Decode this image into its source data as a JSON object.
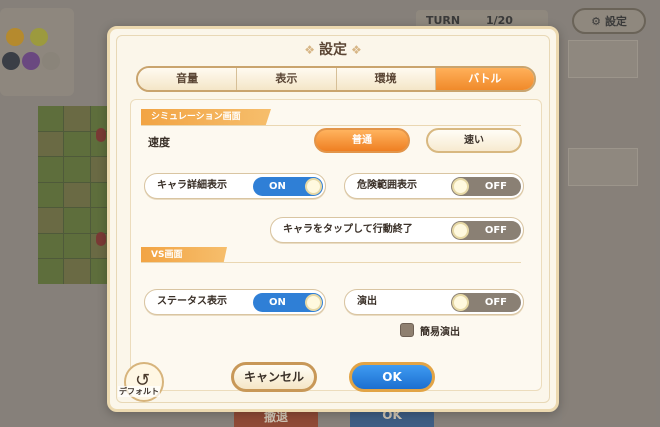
{
  "background": {
    "turn_label": "TURN",
    "turn_value": "1/20",
    "settings_button": "設定",
    "bottom_left_button": "撤退",
    "bottom_right_button": "OK"
  },
  "dialog": {
    "title": "設定",
    "tabs": [
      {
        "label": "音量",
        "active": false
      },
      {
        "label": "表示",
        "active": false
      },
      {
        "label": "環境",
        "active": false
      },
      {
        "label": "バトル",
        "active": true
      }
    ],
    "simulation_section": {
      "header": "シミュレーション画面",
      "speed": {
        "label": "速度",
        "options": [
          {
            "label": "普通",
            "selected": true
          },
          {
            "label": "速い",
            "selected": false
          }
        ]
      },
      "toggles": [
        {
          "label": "キャラ詳細表示",
          "state": "ON"
        },
        {
          "label": "危険範囲表示",
          "state": "OFF"
        },
        {
          "label": "キャラをタップして行動終了",
          "state": "OFF"
        }
      ]
    },
    "vs_section": {
      "header": "VS画面",
      "toggles": [
        {
          "label": "ステータス表示",
          "state": "ON"
        },
        {
          "label": "演出",
          "state": "OFF"
        }
      ],
      "checkbox": {
        "label": "簡易演出",
        "checked": false
      }
    },
    "default_button_label": "デフォルト",
    "cancel_button_label": "キャンセル",
    "ok_button_label": "OK"
  },
  "colors": {
    "accent_orange": "#f08a2a",
    "toggle_on_blue": "#2f7fd6",
    "toggle_off_gray": "#8a8074",
    "dialog_bg": "#fbf6ea"
  }
}
